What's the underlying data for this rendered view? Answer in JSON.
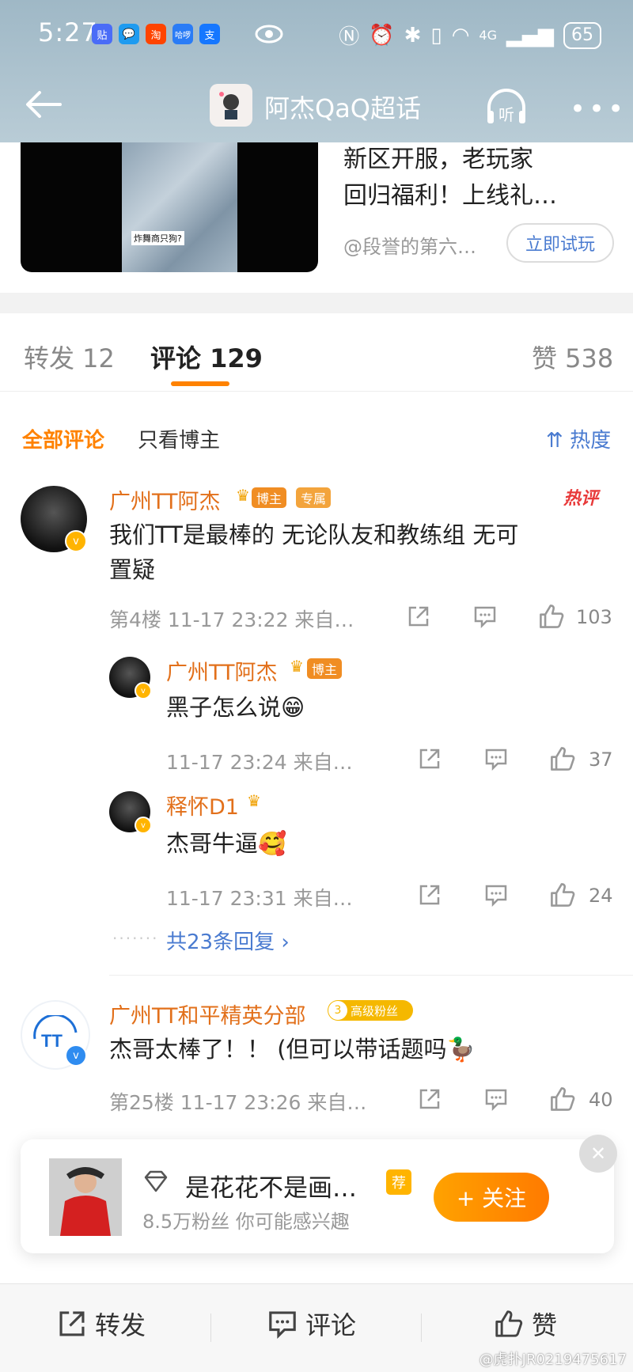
{
  "status_bar": {
    "time": "5:27",
    "app_badges": [
      {
        "text": "贴",
        "color": "#4a6cf7"
      },
      {
        "text": "💬",
        "color": "#1e9bf0"
      },
      {
        "text": "淘",
        "color": "#ff4400"
      },
      {
        "text": "哈啰",
        "color": "#2a7cf6"
      },
      {
        "text": "支",
        "color": "#1677ff"
      }
    ],
    "network": "4G",
    "battery": "65"
  },
  "title_bar": {
    "title": "阿杰QaQ超话",
    "listen_label": "听"
  },
  "promo_card": {
    "video_caption": "炸舞商只狗?",
    "line1": "新区开服，老玩家",
    "line2": "回归福利！上线礼…",
    "source": "@段誉的第六…",
    "try_button": "立即试玩"
  },
  "tabs": {
    "repost": "转发 12",
    "comment": "评论 129",
    "like": "赞 538"
  },
  "filters": {
    "all": "全部评论",
    "author_only": "只看博主",
    "sort": "热度"
  },
  "comments": [
    {
      "username": "广州TT阿杰",
      "badge1": "博主",
      "badge2": "专属",
      "hot_tag": "热评",
      "text_line1": "我们TT是最棒的   无论队友和教练组   无可",
      "text_line2": "置疑",
      "meta": "第4楼  11-17 23:22  来自…",
      "likes": "103"
    },
    {
      "username": "广州TT和平精英分部",
      "fan_level": "3",
      "fan_badge": "高级粉丝",
      "text": "杰哥太棒了！！  (但可以带话题吗🦆",
      "meta": "第25楼  11-17 23:26  来自…",
      "likes": "40"
    }
  ],
  "replies": [
    {
      "username": "广州TT阿杰",
      "badge": "博主",
      "text": "黑子怎么说😁",
      "meta": "11-17 23:24  来自…",
      "likes": "37"
    },
    {
      "username": "释怀D1",
      "text": "杰哥牛逼🥰",
      "meta": "11-17 23:31  来自…",
      "likes": "24"
    }
  ],
  "more_replies": "共23条回复 ›",
  "suggestion": {
    "name": "是花花不是画…",
    "rec": "荐",
    "subtitle": "8.5万粉丝  你可能感兴趣",
    "follow": "+ 关注"
  },
  "bottom_bar": {
    "repost": "转发",
    "comment": "评论",
    "like": "赞"
  },
  "watermark": "@虎扑JR0219475617",
  "colors": {
    "accent": "#ff8200",
    "link": "#4a7bd0",
    "username": "#e2701b"
  }
}
